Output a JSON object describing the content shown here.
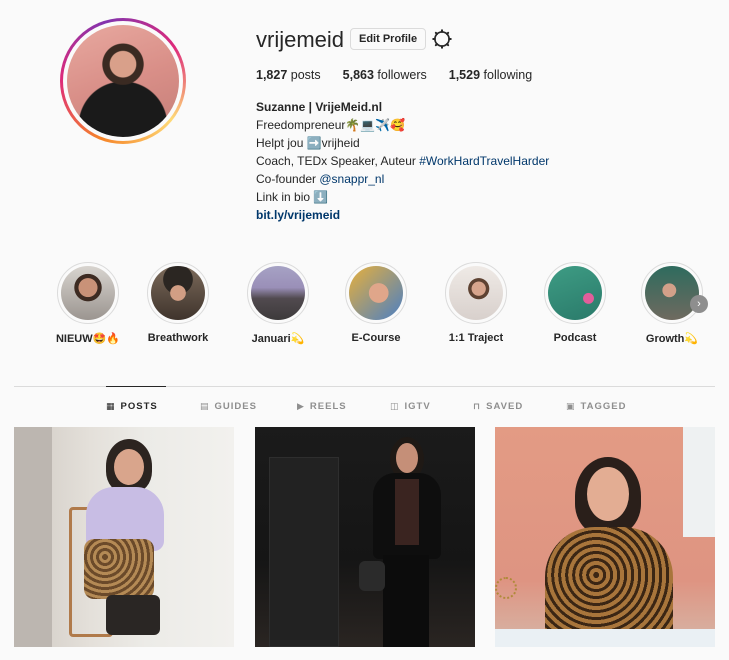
{
  "profile": {
    "username": "vrijemeid",
    "edit_label": "Edit Profile",
    "stats": {
      "posts_count": "1,827",
      "posts_label": "posts",
      "followers_count": "5,863",
      "followers_label": "followers",
      "following_count": "1,529",
      "following_label": "following"
    },
    "bio": {
      "name": "Suzanne | VrijeMeid.nl",
      "line1": "Freedompreneur🌴💻✈️🥰",
      "line2": "Helpt jou ➡️vrijheid",
      "line3_text": "Coach, TEDx Speaker, Auteur ",
      "line3_tag": "#WorkHardTravelHarder",
      "line4_text": "Co-founder ",
      "line4_mention": "@snappr_nl",
      "line5": "Link in bio ⬇️",
      "link": "bit.ly/vrijemeid"
    }
  },
  "highlights": [
    {
      "label": "NIEUW🤩🔥"
    },
    {
      "label": "Breathwork"
    },
    {
      "label": "Januari💫"
    },
    {
      "label": "E-Course"
    },
    {
      "label": "1:1 Traject"
    },
    {
      "label": "Podcast"
    },
    {
      "label": "Growth💫"
    }
  ],
  "tabs": [
    {
      "label": "POSTS",
      "icon": "grid-icon"
    },
    {
      "label": "GUIDES",
      "icon": "guides-icon"
    },
    {
      "label": "REELS",
      "icon": "reels-icon"
    },
    {
      "label": "IGTV",
      "icon": "igtv-icon"
    },
    {
      "label": "SAVED",
      "icon": "bookmark-icon"
    },
    {
      "label": "TAGGED",
      "icon": "tag-icon"
    }
  ],
  "colors": {
    "accent_link": "#00376b",
    "border": "#dbdbdb",
    "muted": "#8e8e8e"
  }
}
